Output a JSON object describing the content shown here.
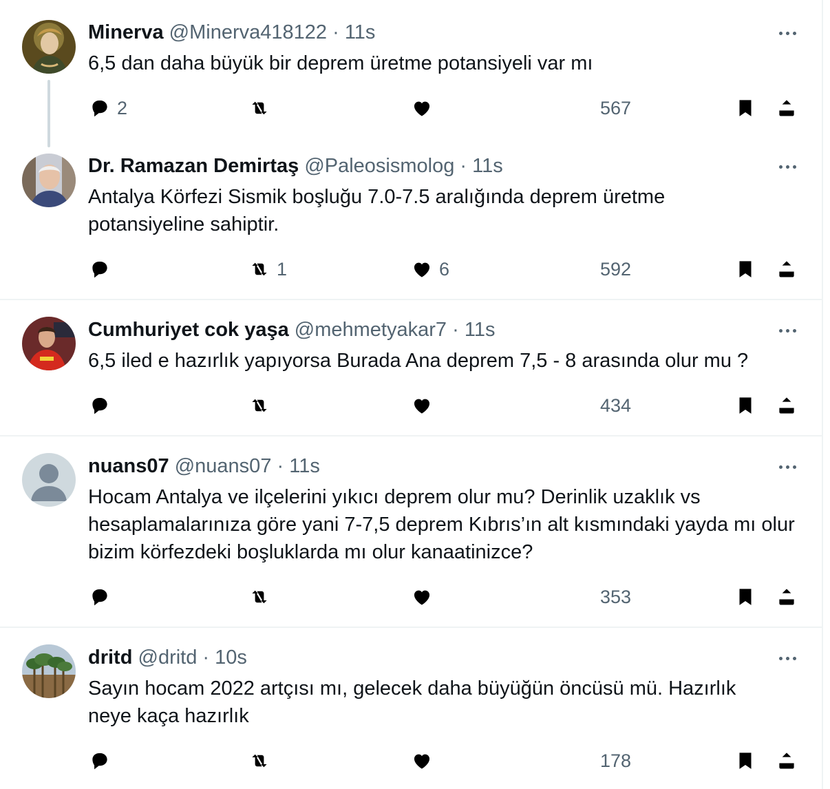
{
  "tweets": [
    {
      "name": "Minerva",
      "handle": "@Minerva418122",
      "time": "11s",
      "text": "6,5 dan daha büyük bir deprem üretme potansiyeli var mı",
      "replies": "2",
      "retweets": "",
      "likes": "",
      "views": "567"
    },
    {
      "name": "Dr. Ramazan Demirtaş",
      "handle": "@Paleosismolog",
      "time": "11s",
      "text": "Antalya Körfezi Sismik boşluğu 7.0-7.5 aralığında deprem üretme potansiyeline sahiptir.",
      "replies": "",
      "retweets": "1",
      "likes": "6",
      "views": "592"
    },
    {
      "name": "Cumhuriyet cok yaşa",
      "handle": "@mehmetyakar7",
      "time": "11s",
      "text": "6,5 iled e hazırlık yapıyorsa Burada Ana deprem 7,5 - 8 arasında olur mu ?",
      "replies": "",
      "retweets": "",
      "likes": "",
      "views": "434"
    },
    {
      "name": "nuans07",
      "handle": "@nuans07",
      "time": "11s",
      "text": "Hocam Antalya ve ilçelerini yıkıcı deprem olur mu? Derinlik uzaklık vs hesaplamalarınıza göre yani 7-7,5 deprem Kıbrıs’ın alt kısmındaki yayda mı olur bizim körfezdeki boşluklarda mı olur kanaatinizce?",
      "replies": "",
      "retweets": "",
      "likes": "",
      "views": "353"
    },
    {
      "name": "dritd",
      "handle": "@dritd",
      "time": "10s",
      "text": "Sayın hocam 2022 artçısı mı, gelecek daha büyüğün öncüsü mü. Hazırlık neye kaça hazırlık",
      "replies": "",
      "retweets": "",
      "likes": "",
      "views": "178"
    }
  ],
  "separator": "·",
  "icons": {
    "reply": "reply-icon",
    "retweet": "retweet-icon",
    "like": "heart-icon",
    "views": "views-icon",
    "bookmark": "bookmark-icon",
    "share": "share-icon",
    "more": "more-icon"
  },
  "colors": {
    "text": "#0f1419",
    "secondary": "#536471",
    "border": "#eff3f4",
    "thread_line": "#cfd9de"
  }
}
